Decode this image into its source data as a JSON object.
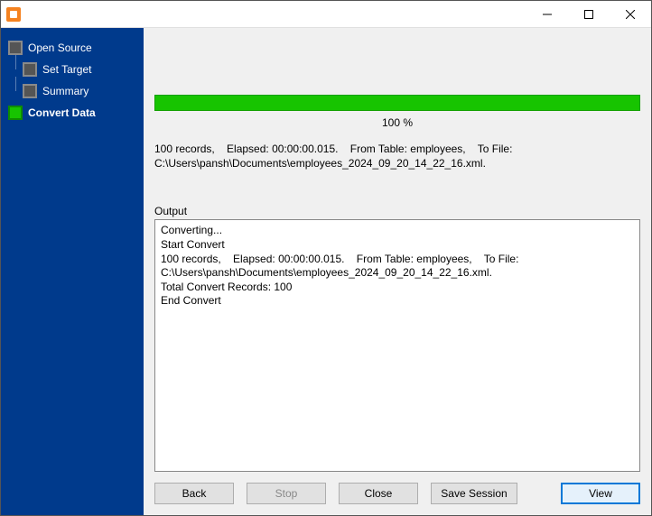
{
  "window": {
    "title": ""
  },
  "sidebar": {
    "items": [
      {
        "label": "Open Source",
        "active": false
      },
      {
        "label": "Set Target",
        "active": false
      },
      {
        "label": "Summary",
        "active": false
      },
      {
        "label": "Convert Data",
        "active": true
      }
    ]
  },
  "progress": {
    "percent_label": "100 %",
    "status": "100 records,    Elapsed: 00:00:00.015.    From Table: employees,    To File: C:\\Users\\pansh\\Documents\\employees_2024_09_20_14_22_16.xml."
  },
  "output": {
    "label": "Output",
    "text": "Converting...\nStart Convert\n100 records,    Elapsed: 00:00:00.015.    From Table: employees,    To File: C:\\Users\\pansh\\Documents\\employees_2024_09_20_14_22_16.xml.\nTotal Convert Records: 100\nEnd Convert"
  },
  "buttons": {
    "back": "Back",
    "stop": "Stop",
    "close": "Close",
    "save_session": "Save Session",
    "view": "View"
  }
}
